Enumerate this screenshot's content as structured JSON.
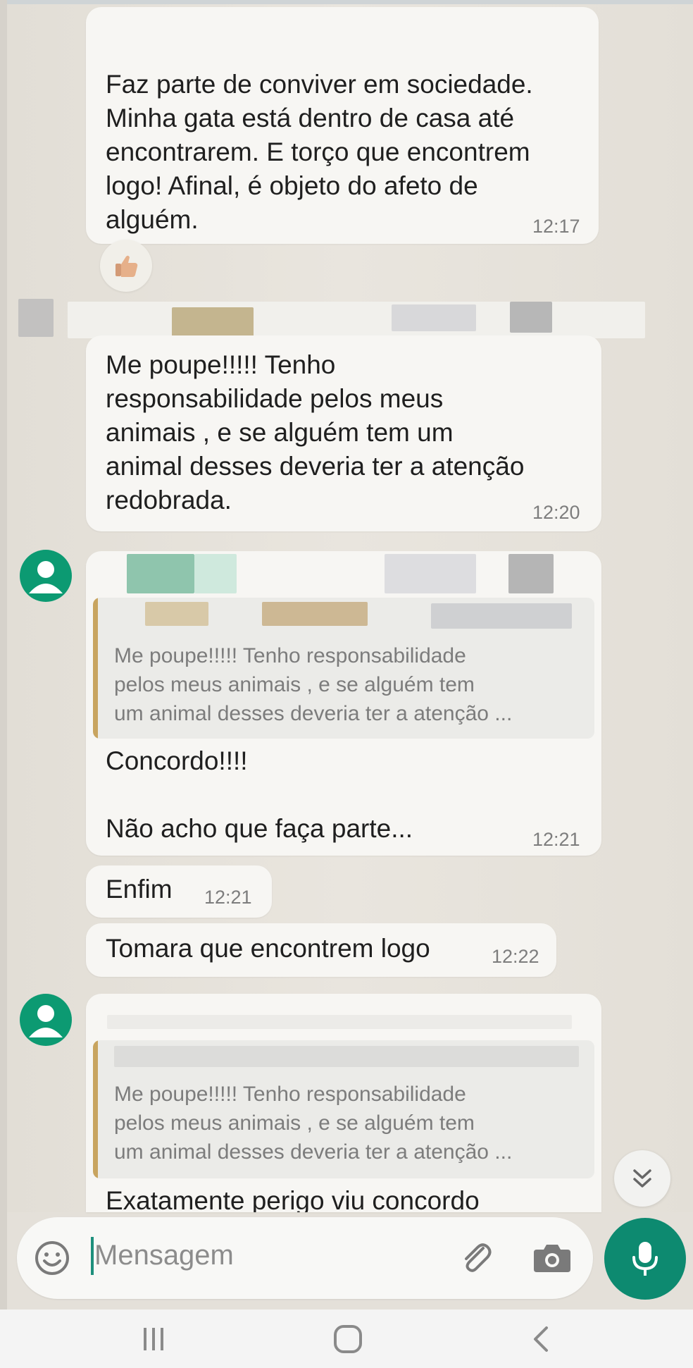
{
  "messages": [
    {
      "text": "Faz parte de conviver em sociedade.\nMinha gata está dentro de casa até\nencontrarem. E torço que encontrem\nlogo! Afinal, é objeto do afeto de\nalguém.",
      "time": "12:17",
      "reaction": "thumbs-up"
    },
    {
      "text": "Me poupe!!!!!  Tenho\nresponsabilidade pelos meus\nanimais , e se alguém tem um\nanimal desses deveria ter a atenção\nredobrada.",
      "time": "12:20"
    },
    {
      "quote": "Me poupe!!!!!  Tenho responsabilidade\npelos meus animais , e se alguém tem\num animal desses deveria ter a atenção ...",
      "text": "Concordo!!!!\n\nNão acho que faça parte...",
      "time": "12:21"
    },
    {
      "text": "Enfim",
      "time": "12:21"
    },
    {
      "text": "Tomara que encontrem logo",
      "time": "12:22"
    },
    {
      "quote": "Me poupe!!!!!  Tenho responsabilidade\npelos meus animais , e se alguém tem\num animal desses deveria ter a atenção ...",
      "text": "Exatamente perigo viu concordo"
    }
  ],
  "composer": {
    "placeholder": "Mensagem"
  },
  "icons": {
    "emoji": "emoji-icon",
    "attach": "paperclip-icon",
    "camera": "camera-icon",
    "mic": "microphone-icon",
    "scroll": "double-chevron-down-icon",
    "nav_recent": "recent-apps-icon",
    "nav_home": "home-icon",
    "nav_back": "back-icon"
  },
  "colors": {
    "accent": "#0d8a70",
    "avatar": "#0c9a72",
    "quote_bar": "#c8a45f",
    "bubble": "#f7f6f3",
    "chat_background": "#e4e0d9"
  }
}
